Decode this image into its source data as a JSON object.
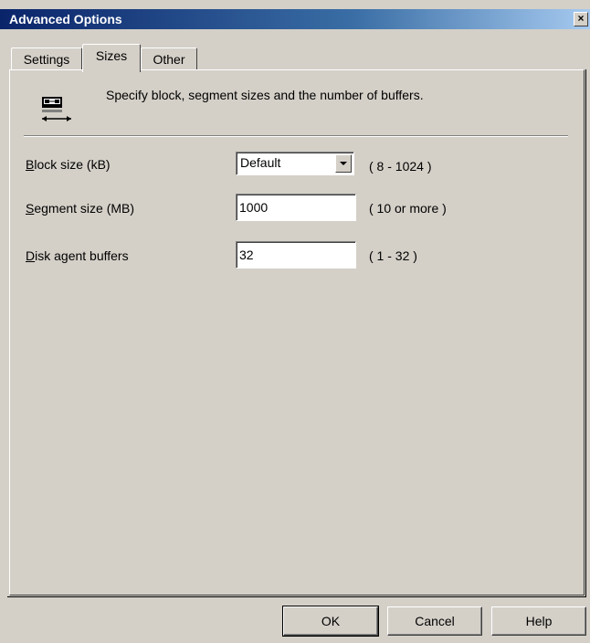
{
  "window": {
    "title": "Advanced Options",
    "close_glyph": "×"
  },
  "tabs": [
    {
      "label": "Settings",
      "selected": false
    },
    {
      "label": "Sizes",
      "selected": true
    },
    {
      "label": "Other",
      "selected": false
    }
  ],
  "header": {
    "icon": "tape-cartridge-icon",
    "description": "Specify block, segment sizes and the number of buffers."
  },
  "fields": {
    "block_size": {
      "label_mnemonic": "B",
      "label_rest": "lock size (kB)",
      "value": "Default",
      "range": "( 8 - 1024 )"
    },
    "segment_size": {
      "label_mnemonic": "S",
      "label_rest": "egment size (MB)",
      "value": "1000",
      "range": "( 10 or more )"
    },
    "disk_agent_buffers": {
      "label_mnemonic": "D",
      "label_rest": "isk agent buffers",
      "value": "32",
      "range": "( 1 - 32 )"
    }
  },
  "buttons": {
    "ok": "OK",
    "cancel": "Cancel",
    "help": "Help"
  },
  "colors": {
    "titlebar_start": "#0a246a",
    "titlebar_end": "#a6caf0",
    "face": "#d4d0c8"
  }
}
